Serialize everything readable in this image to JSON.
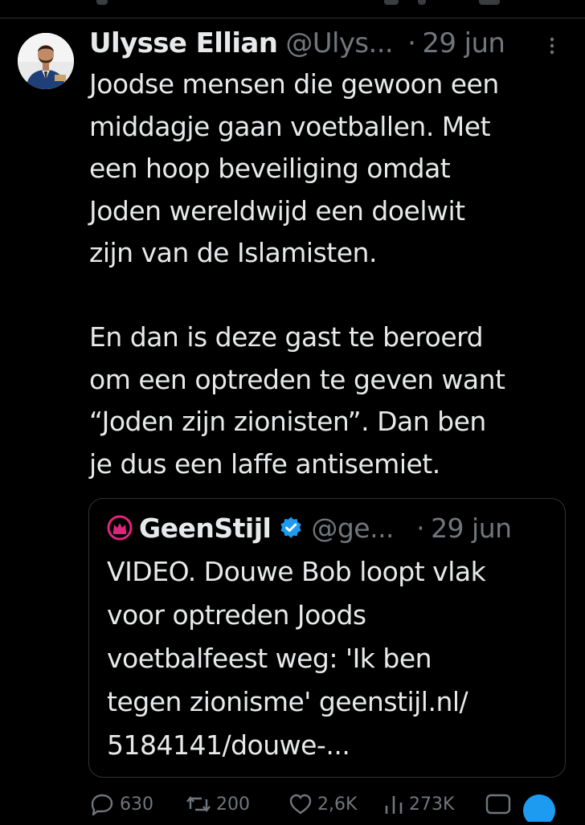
{
  "tweet": {
    "author": {
      "display_name": "Ulysse Ellian",
      "handle": "@Ulys...",
      "avatar_icon": "profile-photo"
    },
    "separator": "·",
    "date": "29 jun",
    "body_lines": [
      "Joodse mensen die gewoon een",
      "middagje gaan voetballen. Met",
      "een hoop beveiliging omdat",
      "Joden wereldwijd een doelwit",
      "zijn van de Islamisten.",
      "",
      "En dan is deze gast te beroerd",
      "om een optreden te geven want",
      "“Joden zijn zionisten”. Dan ben",
      "je dus een laffe antisemiet."
    ]
  },
  "quote": {
    "author": {
      "display_name": "GeenStijl",
      "handle": "@ge...",
      "logo_icon": "geenstijl-crown-logo",
      "verified_icon": "verified-badge-icon"
    },
    "separator": "·",
    "date": "29 jun",
    "body_lines": [
      "VIDEO. Douwe Bob loopt vlak",
      "voor optreden Joods",
      "voetbalfeest weg: 'Ik ben",
      "tegen zionisme' geenstijl.nl/",
      "5184141/douwe-..."
    ]
  },
  "actions": [
    {
      "name": "reply",
      "icon": "reply-icon",
      "count": "630"
    },
    {
      "name": "repost",
      "icon": "repost-icon",
      "count": "200"
    },
    {
      "name": "like",
      "icon": "heart-icon",
      "count": "2,6K"
    },
    {
      "name": "views",
      "icon": "views-icon",
      "count": "273K"
    },
    {
      "name": "share",
      "icon": "share-icon",
      "count": ""
    }
  ],
  "colors": {
    "background": "#000000",
    "text_primary": "#e7e9ea",
    "text_secondary": "#71767b",
    "border": "#2f3336",
    "verified_blue": "#1d9bf0",
    "geenstijl_pink": "#e0247b"
  }
}
